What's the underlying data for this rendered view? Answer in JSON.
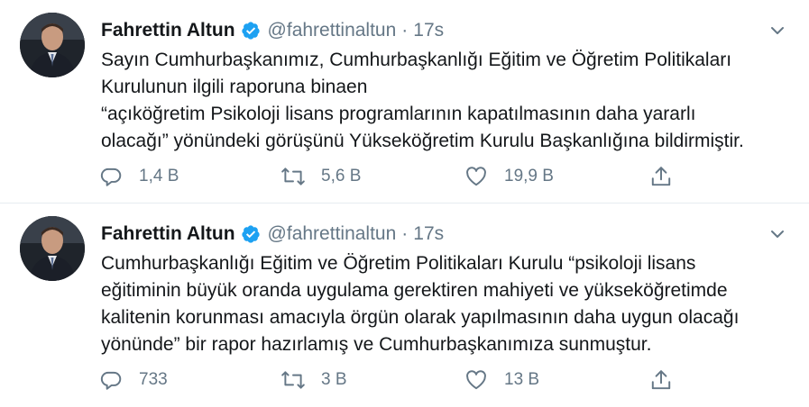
{
  "tweets": [
    {
      "author_name": "Fahrettin Altun",
      "handle": "@fahrettinaltun",
      "separator": "·",
      "time": "17s",
      "text_lines": [
        "Sayın Cumhurbaşkanımız, Cumhurbaşkanlığı Eğitim ve Öğretim Politikaları",
        "Kurulunun ilgili raporuna binaen",
        "“açıköğretim Psikoloji lisans programlarının kapatılmasının daha yararlı",
        "olacağı” yönündeki görüşünü Yükseköğretim Kurulu Başkanlığına bildirmiştir."
      ],
      "replies": "1,4 B",
      "retweets": "5,6 B",
      "likes": "19,9 B"
    },
    {
      "author_name": "Fahrettin Altun",
      "handle": "@fahrettinaltun",
      "separator": "·",
      "time": "17s",
      "text_lines": [
        "Cumhurbaşkanlığı Eğitim ve Öğretim Politikaları Kurulu “psikoloji lisans",
        "eğitiminin büyük oranda uygulama gerektiren mahiyeti ve yükseköğretimde",
        "kalitenin korunması amacıyla örgün olarak yapılmasının daha uygun olacağı",
        "yönünde” bir rapor hazırlamış ve Cumhurbaşkanımıza sunmuştur."
      ],
      "replies": "733",
      "retweets": "3 B",
      "likes": "13 B"
    }
  ],
  "colors": {
    "text": "#14171a",
    "muted": "#657786",
    "verified": "#1da1f2",
    "divider": "#e6ecf0"
  },
  "icons": [
    "verified-badge-icon",
    "chevron-down-icon",
    "reply-icon",
    "retweet-icon",
    "like-icon",
    "share-icon"
  ]
}
